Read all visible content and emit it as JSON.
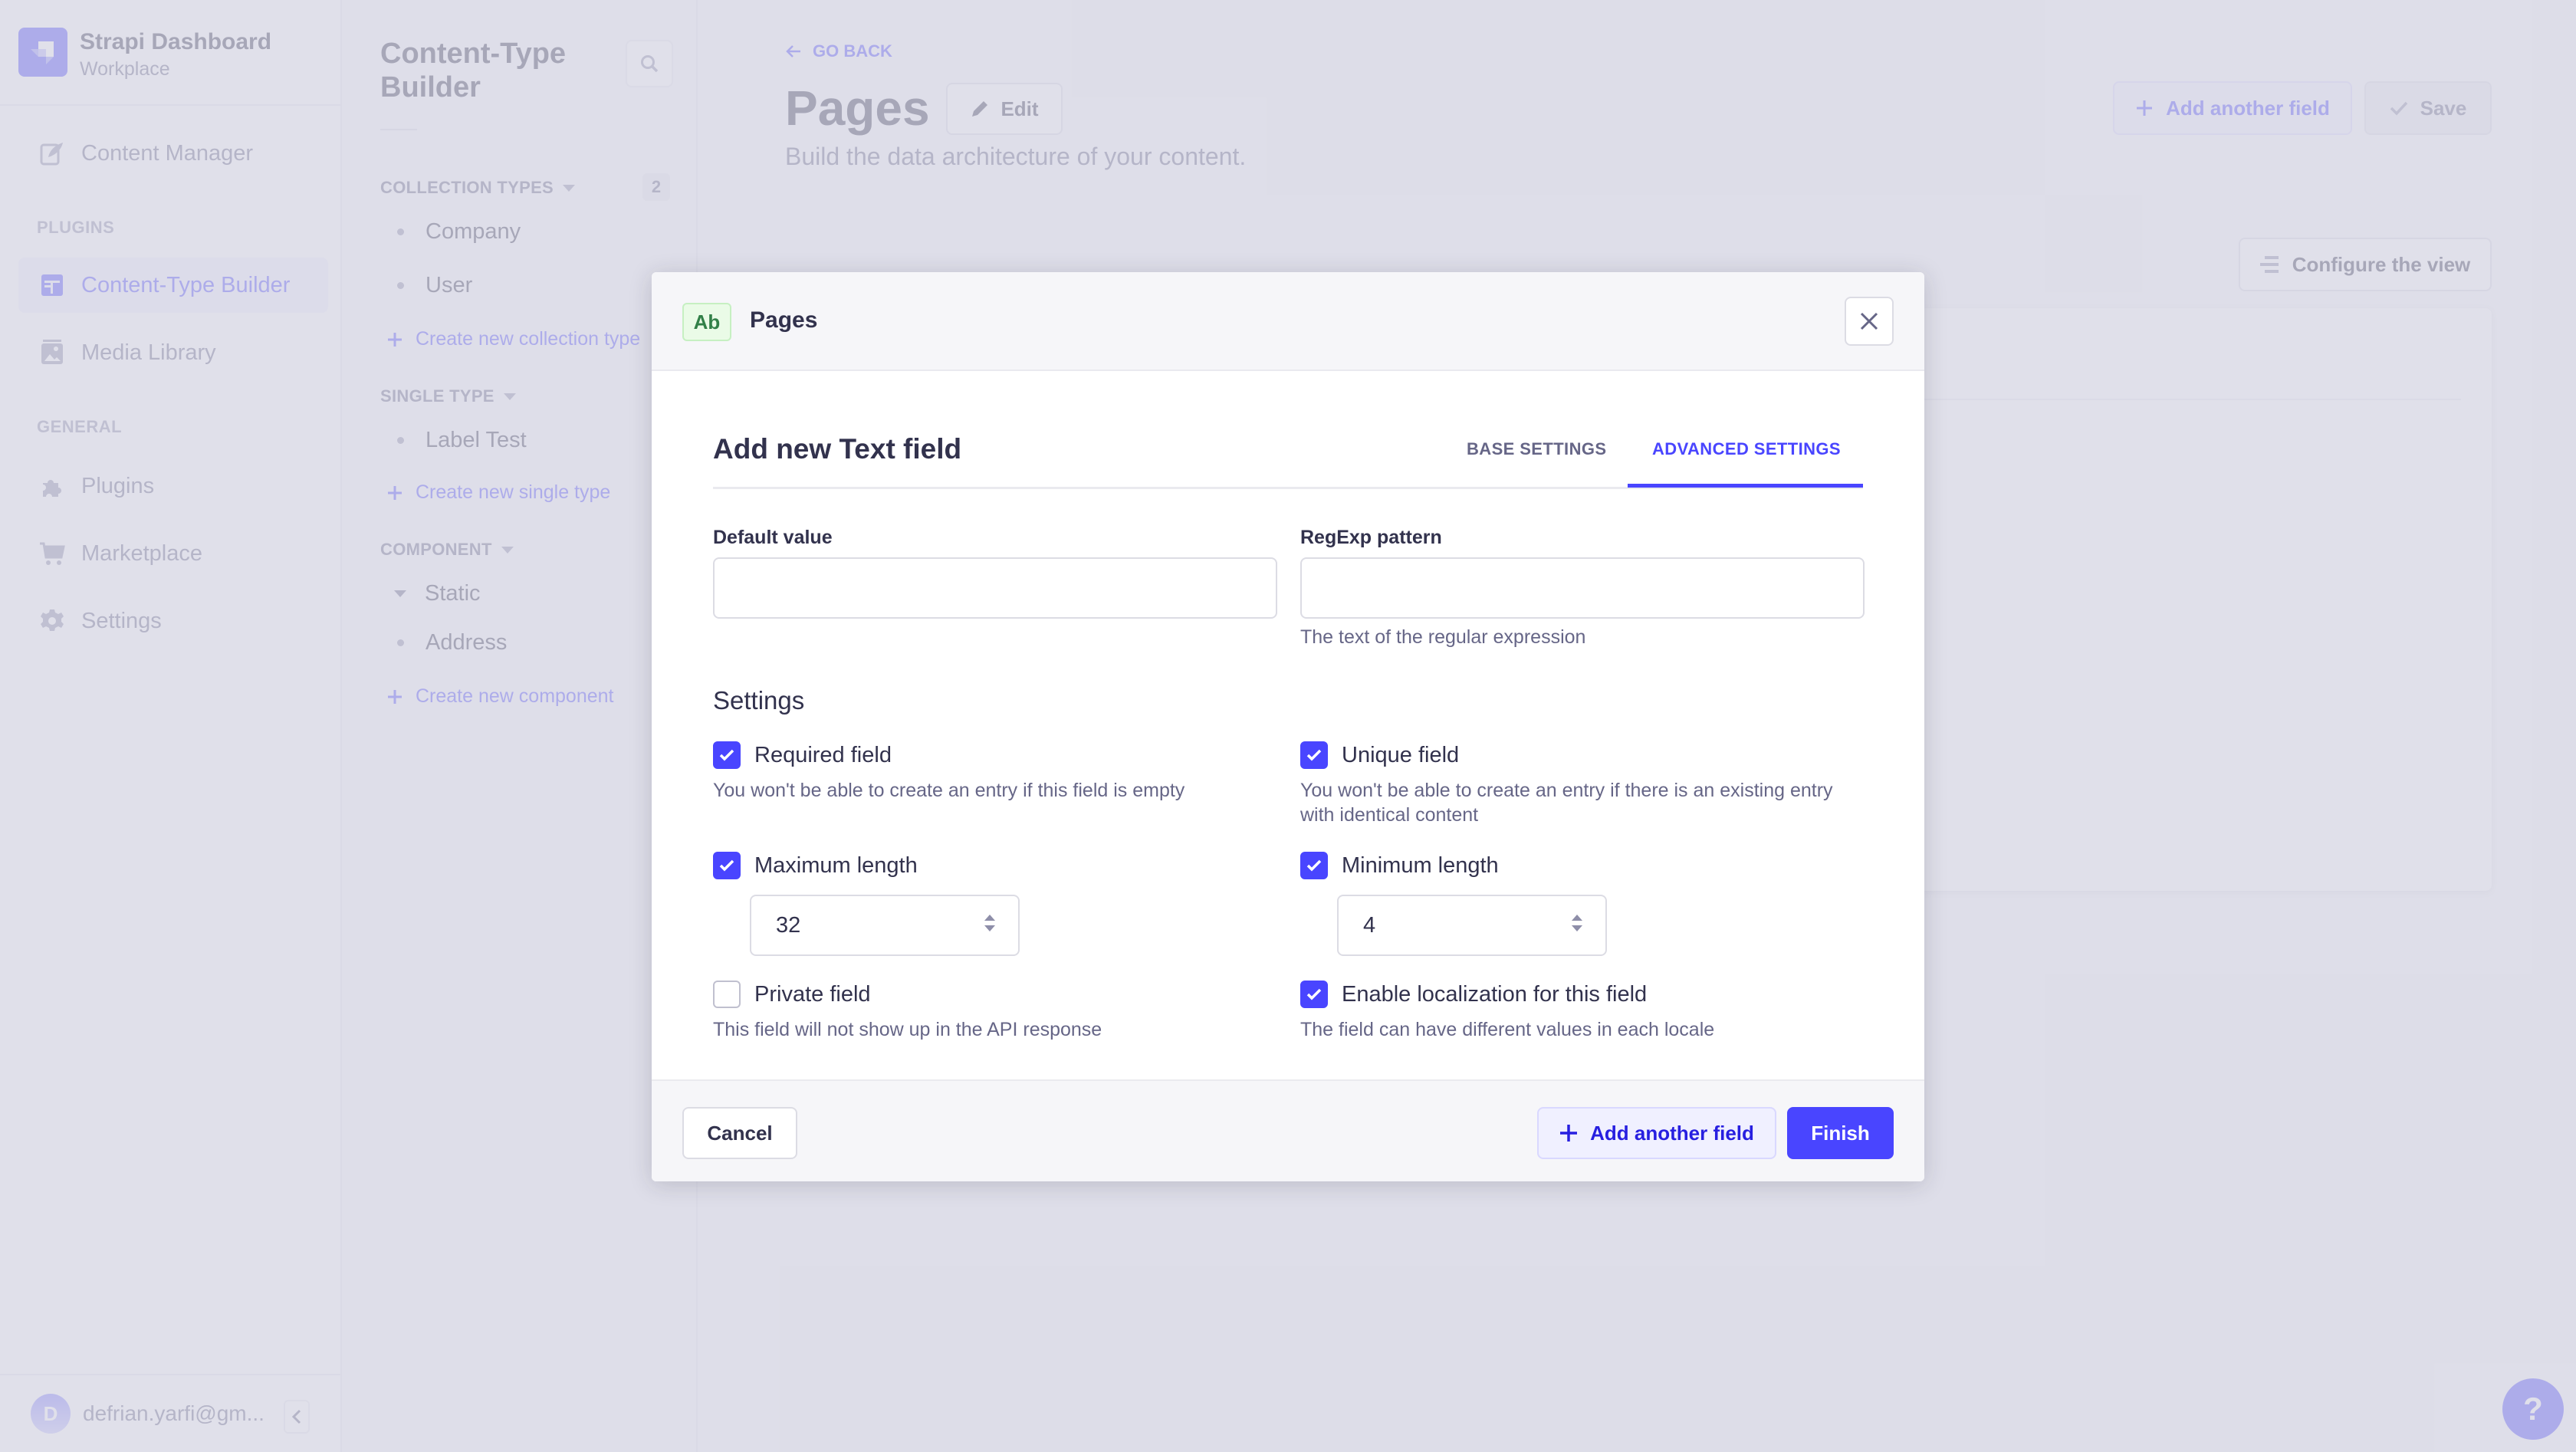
{
  "app": {
    "brand_title": "Strapi Dashboard",
    "brand_subtitle": "Workplace",
    "accent_color": "#4945ff"
  },
  "mainnav": {
    "items_top": [
      {
        "label": "Content Manager",
        "icon": "feather-icon"
      }
    ],
    "plugins_section": "PLUGINS",
    "plugins": [
      {
        "label": "Content-Type Builder",
        "icon": "layout-icon",
        "active": true
      },
      {
        "label": "Media Library",
        "icon": "image-icon"
      }
    ],
    "general_section": "GENERAL",
    "general": [
      {
        "label": "Plugins",
        "icon": "puzzle-icon"
      },
      {
        "label": "Marketplace",
        "icon": "cart-icon"
      },
      {
        "label": "Settings",
        "icon": "gear-icon"
      }
    ],
    "user": {
      "initial": "D",
      "email": "defrian.yarfi@gm..."
    }
  },
  "subnav": {
    "title_line1": "Content-Type",
    "title_line2": "Builder",
    "collection_types": {
      "label": "COLLECTION TYPES",
      "count": "2",
      "items": [
        "Company",
        "User"
      ],
      "create": "Create new collection type"
    },
    "single_type": {
      "label": "SINGLE TYPE",
      "items": [
        "Label Test"
      ],
      "create": "Create new single type"
    },
    "component": {
      "label": "COMPONENT",
      "group": "Static",
      "items": [
        "Address"
      ],
      "create": "Create new component"
    }
  },
  "content": {
    "go_back": "GO BACK",
    "title": "Pages",
    "edit_label": "Edit",
    "subtitle": "Build the data architecture of your content.",
    "add_another_field": "Add another field",
    "save": "Save",
    "configure_view": "Configure the view"
  },
  "modal": {
    "type_badge": "Ab",
    "content_type": "Pages",
    "title": "Add new Text field",
    "tabs": [
      {
        "label": "BASE SETTINGS",
        "active": false
      },
      {
        "label": "ADVANCED SETTINGS",
        "active": true
      }
    ],
    "default_value": {
      "label": "Default value",
      "value": ""
    },
    "regexp": {
      "label": "RegExp pattern",
      "value": "",
      "hint": "The text of the regular expression"
    },
    "settings_title": "Settings",
    "settings": {
      "required": {
        "label": "Required field",
        "checked": true,
        "desc": "You won't be able to create an entry if this field is empty"
      },
      "unique": {
        "label": "Unique field",
        "checked": true,
        "desc": "You won't be able to create an entry if there is an existing entry with identical content"
      },
      "max_length": {
        "label": "Maximum length",
        "checked": true,
        "value": "32"
      },
      "min_length": {
        "label": "Minimum length",
        "checked": true,
        "value": "4"
      },
      "private": {
        "label": "Private field",
        "checked": false,
        "desc": "This field will not show up in the API response"
      },
      "localization": {
        "label": "Enable localization for this field",
        "checked": true,
        "desc": "The field can have different values in each locale"
      }
    },
    "footer": {
      "cancel": "Cancel",
      "add_another_field": "Add another field",
      "finish": "Finish"
    }
  },
  "help_label": "?"
}
